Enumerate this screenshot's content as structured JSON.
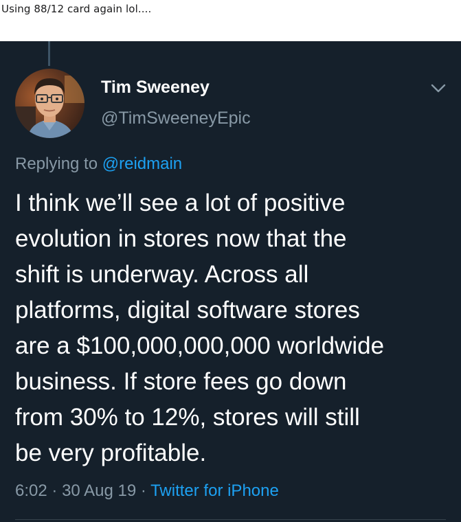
{
  "post": {
    "caption": "Using 88/12 card again lol...."
  },
  "tweet": {
    "display_name": "Tim Sweeney",
    "handle": "@TimSweeneyEpic",
    "replying_prefix": "Replying to ",
    "replying_to": "@reidmain",
    "body_lines": [
      "I think we’ll see a lot of positive",
      "evolution in stores now that the",
      "shift is underway. Across all",
      "platforms, digital software stores",
      "are a $100,000,000,000 worldwide",
      "business. If store fees go down",
      "from 30% to 12%, stores will still",
      "be very profitable."
    ],
    "time": "6:02",
    "separator": "·",
    "date": "30 Aug 19",
    "source": "Twitter for iPhone"
  },
  "icons": {
    "menu": "chevron-down-icon",
    "avatar": "profile-photo"
  },
  "colors": {
    "background": "#15202b",
    "text_primary": "#ffffff",
    "text_secondary": "#8899a6",
    "accent": "#1da1f2"
  }
}
